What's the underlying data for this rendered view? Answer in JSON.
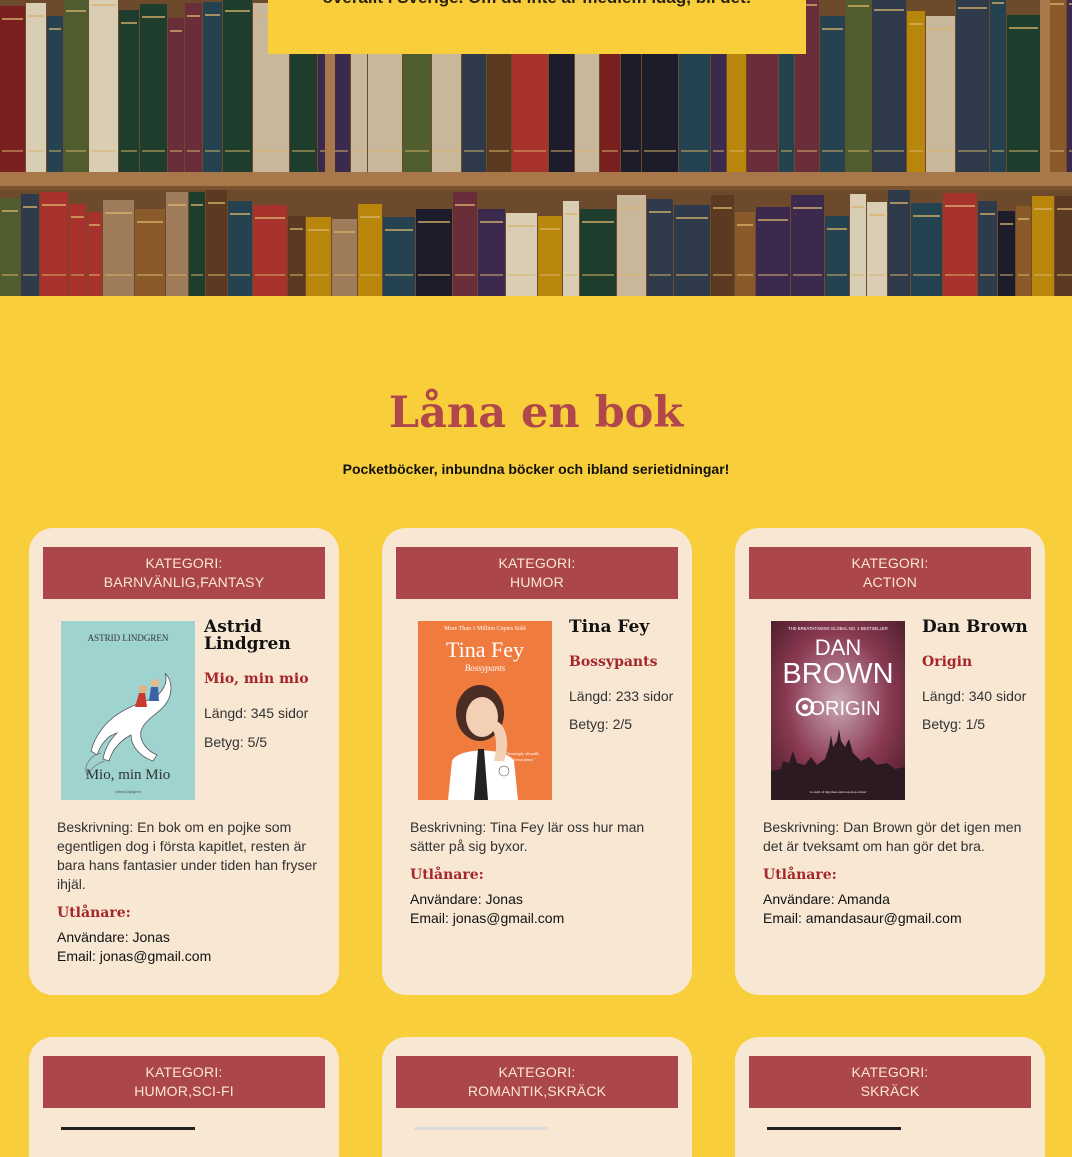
{
  "hero": {
    "banner_text": "överallt i Sverige. Om du inte är medlem idag, bli det!"
  },
  "section": {
    "title": "Låna en bok",
    "subtitle": "Pocketböcker, inbundna böcker och ibland serietidningar!"
  },
  "labels": {
    "lender_heading": "Utlånare:"
  },
  "books": [
    {
      "category_label": "KATEGORI:",
      "category": "BARNVÄNLIG,FANTASY",
      "author": "Astrid Lindgren",
      "title": "Mio, min mio",
      "length": "Längd: 345 sidor",
      "rating": "Betyg: 5/5",
      "description": "Beskrivning: En bok om en pojke som egentligen dog i första kapitlet, resten är bara hans fantasier under tiden han fryser ihjäl.",
      "user": "Användare: Jonas",
      "email": "Email: jonas@gmail.com",
      "cover_top": "ASTRID LINDGREN",
      "cover_title": "Mio, min Mio",
      "cover_color": "#9fd3cf"
    },
    {
      "category_label": "KATEGORI:",
      "category": "HUMOR",
      "author": "Tina Fey",
      "title": "Bossypants",
      "length": "Längd: 233 sidor",
      "rating": "Betyg: 2/5",
      "description": "Beskrivning: Tina Fey lär oss hur man sätter på sig byxor.",
      "user": "Användare: Jonas",
      "email": "Email: jonas@gmail.com",
      "cover_top": "More Than 1 Million Copies Sold",
      "cover_title": "Tina Fey",
      "cover_sub": "Bossypants",
      "cover_color": "#f07b3f"
    },
    {
      "category_label": "KATEGORI:",
      "category": "ACTION",
      "author": "Dan Brown",
      "title": "Origin",
      "length": "Längd: 340 sidor",
      "rating": "Betyg: 1/5",
      "description": "Beskrivning: Dan Brown gör det igen men det är tveksamt om han gör det bra.",
      "user": "Användare: Amanda",
      "email": "Email: amandasaur@gmail.com",
      "cover_top": "THE BREATHTAKING GLOBAL NO. 1 BESTSELLER",
      "cover_title_1": "DAN",
      "cover_title_2": "BROWN",
      "cover_title_3": "ORIGIN",
      "cover_color": "#7c2838"
    }
  ],
  "books_row2": [
    {
      "category_label": "KATEGORI:",
      "category": "HUMOR,SCI-FI"
    },
    {
      "category_label": "KATEGORI:",
      "category": "ROMANTIK,SKRÄCK"
    },
    {
      "category_label": "KATEGORI:",
      "category": "SKRÄCK"
    }
  ],
  "colors": {
    "page_background": "#f8cf3a",
    "card_background": "#f8e7d2",
    "category_bar": "#ab474a",
    "accent_red": "#a5262b",
    "heading_red": "#b0484b"
  }
}
